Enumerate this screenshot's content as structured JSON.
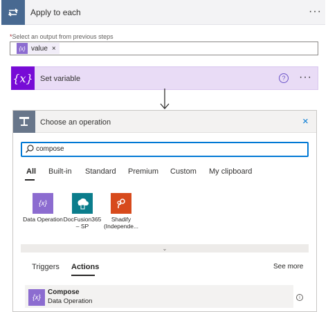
{
  "apply_each": {
    "title": "Apply to each",
    "more": "···"
  },
  "output": {
    "label": "Select an output from previous steps",
    "required_mark": "*",
    "token": {
      "value": "value",
      "remove": "×"
    }
  },
  "set_variable": {
    "title": "Set variable",
    "help": "?",
    "more": "···"
  },
  "operation": {
    "title": "Choose an operation",
    "close": "×",
    "search_value": "compose",
    "tabs": [
      "All",
      "Built-in",
      "Standard",
      "Premium",
      "Custom",
      "My clipboard"
    ],
    "connectors": [
      {
        "name": "Data Operation",
        "color": "#8c6cd0",
        "icon": "data-operation-icon"
      },
      {
        "name": "DocFusion365 – SP",
        "color": "#0b7d8c",
        "icon": "docfusion-icon"
      },
      {
        "name": "Shadify (Independe...",
        "color": "#d74a1c",
        "icon": "shadify-icon"
      }
    ],
    "result_tabs": [
      "Triggers",
      "Actions"
    ],
    "see_more": "See more",
    "results": [
      {
        "name": "Compose",
        "subtitle": "Data Operation",
        "info": "i"
      }
    ]
  }
}
